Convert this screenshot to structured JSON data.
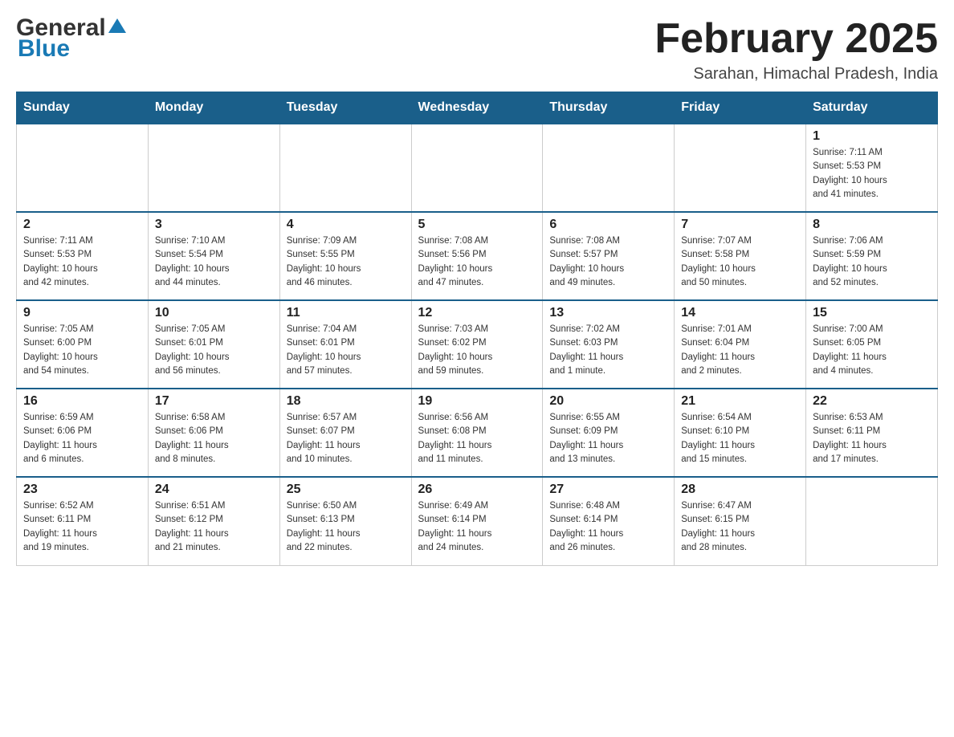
{
  "header": {
    "logo_general": "General",
    "logo_blue": "Blue",
    "main_title": "February 2025",
    "subtitle": "Sarahan, Himachal Pradesh, India"
  },
  "calendar": {
    "days_of_week": [
      "Sunday",
      "Monday",
      "Tuesday",
      "Wednesday",
      "Thursday",
      "Friday",
      "Saturday"
    ],
    "weeks": [
      [
        {
          "day": "",
          "info": ""
        },
        {
          "day": "",
          "info": ""
        },
        {
          "day": "",
          "info": ""
        },
        {
          "day": "",
          "info": ""
        },
        {
          "day": "",
          "info": ""
        },
        {
          "day": "",
          "info": ""
        },
        {
          "day": "1",
          "info": "Sunrise: 7:11 AM\nSunset: 5:53 PM\nDaylight: 10 hours\nand 41 minutes."
        }
      ],
      [
        {
          "day": "2",
          "info": "Sunrise: 7:11 AM\nSunset: 5:53 PM\nDaylight: 10 hours\nand 42 minutes."
        },
        {
          "day": "3",
          "info": "Sunrise: 7:10 AM\nSunset: 5:54 PM\nDaylight: 10 hours\nand 44 minutes."
        },
        {
          "day": "4",
          "info": "Sunrise: 7:09 AM\nSunset: 5:55 PM\nDaylight: 10 hours\nand 46 minutes."
        },
        {
          "day": "5",
          "info": "Sunrise: 7:08 AM\nSunset: 5:56 PM\nDaylight: 10 hours\nand 47 minutes."
        },
        {
          "day": "6",
          "info": "Sunrise: 7:08 AM\nSunset: 5:57 PM\nDaylight: 10 hours\nand 49 minutes."
        },
        {
          "day": "7",
          "info": "Sunrise: 7:07 AM\nSunset: 5:58 PM\nDaylight: 10 hours\nand 50 minutes."
        },
        {
          "day": "8",
          "info": "Sunrise: 7:06 AM\nSunset: 5:59 PM\nDaylight: 10 hours\nand 52 minutes."
        }
      ],
      [
        {
          "day": "9",
          "info": "Sunrise: 7:05 AM\nSunset: 6:00 PM\nDaylight: 10 hours\nand 54 minutes."
        },
        {
          "day": "10",
          "info": "Sunrise: 7:05 AM\nSunset: 6:01 PM\nDaylight: 10 hours\nand 56 minutes."
        },
        {
          "day": "11",
          "info": "Sunrise: 7:04 AM\nSunset: 6:01 PM\nDaylight: 10 hours\nand 57 minutes."
        },
        {
          "day": "12",
          "info": "Sunrise: 7:03 AM\nSunset: 6:02 PM\nDaylight: 10 hours\nand 59 minutes."
        },
        {
          "day": "13",
          "info": "Sunrise: 7:02 AM\nSunset: 6:03 PM\nDaylight: 11 hours\nand 1 minute."
        },
        {
          "day": "14",
          "info": "Sunrise: 7:01 AM\nSunset: 6:04 PM\nDaylight: 11 hours\nand 2 minutes."
        },
        {
          "day": "15",
          "info": "Sunrise: 7:00 AM\nSunset: 6:05 PM\nDaylight: 11 hours\nand 4 minutes."
        }
      ],
      [
        {
          "day": "16",
          "info": "Sunrise: 6:59 AM\nSunset: 6:06 PM\nDaylight: 11 hours\nand 6 minutes."
        },
        {
          "day": "17",
          "info": "Sunrise: 6:58 AM\nSunset: 6:06 PM\nDaylight: 11 hours\nand 8 minutes."
        },
        {
          "day": "18",
          "info": "Sunrise: 6:57 AM\nSunset: 6:07 PM\nDaylight: 11 hours\nand 10 minutes."
        },
        {
          "day": "19",
          "info": "Sunrise: 6:56 AM\nSunset: 6:08 PM\nDaylight: 11 hours\nand 11 minutes."
        },
        {
          "day": "20",
          "info": "Sunrise: 6:55 AM\nSunset: 6:09 PM\nDaylight: 11 hours\nand 13 minutes."
        },
        {
          "day": "21",
          "info": "Sunrise: 6:54 AM\nSunset: 6:10 PM\nDaylight: 11 hours\nand 15 minutes."
        },
        {
          "day": "22",
          "info": "Sunrise: 6:53 AM\nSunset: 6:11 PM\nDaylight: 11 hours\nand 17 minutes."
        }
      ],
      [
        {
          "day": "23",
          "info": "Sunrise: 6:52 AM\nSunset: 6:11 PM\nDaylight: 11 hours\nand 19 minutes."
        },
        {
          "day": "24",
          "info": "Sunrise: 6:51 AM\nSunset: 6:12 PM\nDaylight: 11 hours\nand 21 minutes."
        },
        {
          "day": "25",
          "info": "Sunrise: 6:50 AM\nSunset: 6:13 PM\nDaylight: 11 hours\nand 22 minutes."
        },
        {
          "day": "26",
          "info": "Sunrise: 6:49 AM\nSunset: 6:14 PM\nDaylight: 11 hours\nand 24 minutes."
        },
        {
          "day": "27",
          "info": "Sunrise: 6:48 AM\nSunset: 6:14 PM\nDaylight: 11 hours\nand 26 minutes."
        },
        {
          "day": "28",
          "info": "Sunrise: 6:47 AM\nSunset: 6:15 PM\nDaylight: 11 hours\nand 28 minutes."
        },
        {
          "day": "",
          "info": ""
        }
      ]
    ]
  }
}
